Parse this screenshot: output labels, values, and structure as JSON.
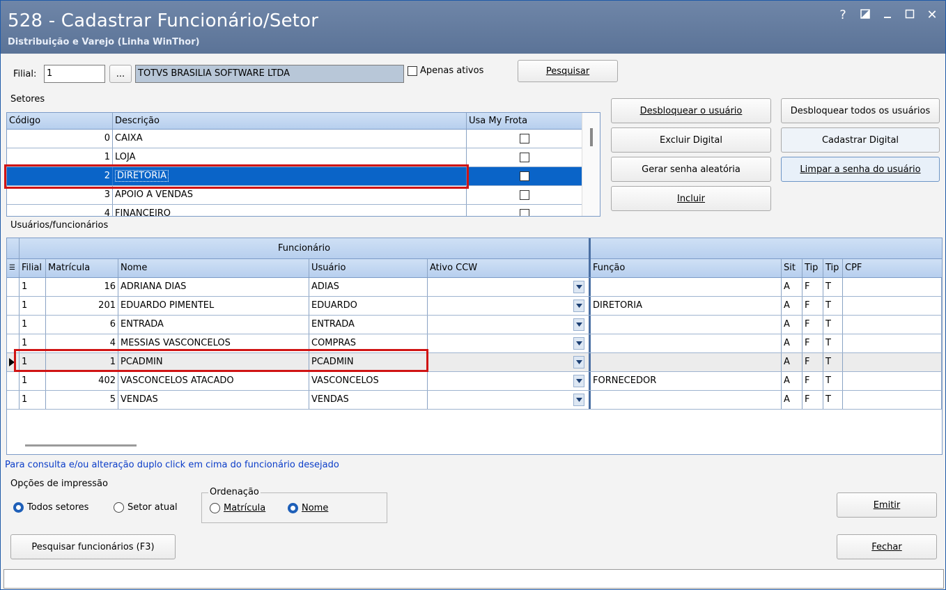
{
  "window": {
    "title": "528 - Cadastrar Funcionário/Setor",
    "subtitle": "Distribuição e Varejo (Linha WinThor)",
    "controls": [
      "help-icon",
      "restore-icon",
      "minimize-icon",
      "maximize-icon",
      "close-icon"
    ],
    "help_glyph": "?",
    "close_glyph": "✕"
  },
  "filter": {
    "filial_label": "Filial:",
    "filial_value": "1",
    "lookup_button": "...",
    "company_name": "TOTVS BRASILIA SOFTWARE LTDA",
    "apenas_ativos_label": "Apenas ativos",
    "pesquisar_label": "Pesquisar"
  },
  "setores": {
    "group_title": "Setores",
    "columns": [
      "Código",
      "Descrição",
      "Usa My Frota"
    ],
    "rows": [
      {
        "codigo": "0",
        "descricao": "CAIXA"
      },
      {
        "codigo": "1",
        "descricao": "LOJA"
      },
      {
        "codigo": "2",
        "descricao": "DIRETORIA"
      },
      {
        "codigo": "3",
        "descricao": "APOIO A VENDAS"
      },
      {
        "codigo": "4",
        "descricao": "FINANCEIRO"
      }
    ],
    "selected_index": 2
  },
  "actions": {
    "desbloquear_usuario": "Desbloquear o usuário",
    "desbloquear_todos": "Desbloquear todos os usuários",
    "excluir_digital": "Excluir Digital",
    "cadastrar_digital": "Cadastrar Digital",
    "gerar_senha": "Gerar senha aleatória",
    "limpar_senha": "Limpar a senha do usuário",
    "incluir": "Incluir"
  },
  "usuarios": {
    "group_title": "Usuários/funcionários",
    "band_title": "Funcionário",
    "columns": [
      "Filial",
      "Matrícula",
      "Nome",
      "Usuário",
      "Ativo CCW",
      "Função",
      "Sit",
      "Tip",
      "Tip",
      "CPF"
    ],
    "rows": [
      {
        "filial": "1",
        "matricula": "16",
        "nome": "ADRIANA DIAS",
        "usuario": "ADIAS",
        "funcao": "",
        "sit": "A",
        "tip1": "F",
        "tip2": "T"
      },
      {
        "filial": "1",
        "matricula": "201",
        "nome": "EDUARDO PIMENTEL",
        "usuario": "EDUARDO",
        "funcao": "DIRETORIA",
        "sit": "A",
        "tip1": "F",
        "tip2": "T"
      },
      {
        "filial": "1",
        "matricula": "6",
        "nome": "ENTRADA",
        "usuario": "ENTRADA",
        "funcao": "",
        "sit": "A",
        "tip1": "F",
        "tip2": "T"
      },
      {
        "filial": "1",
        "matricula": "4",
        "nome": "MESSIAS VASCONCELOS",
        "usuario": "COMPRAS",
        "funcao": "",
        "sit": "A",
        "tip1": "F",
        "tip2": "T"
      },
      {
        "filial": "1",
        "matricula": "1",
        "nome": "PCADMIN",
        "usuario": "PCADMIN",
        "funcao": "",
        "sit": "A",
        "tip1": "F",
        "tip2": "T"
      },
      {
        "filial": "1",
        "matricula": "402",
        "nome": "VASCONCELOS ATACADO",
        "usuario": "VASCONCELOS",
        "funcao": "FORNECEDOR",
        "sit": "A",
        "tip1": "F",
        "tip2": "T"
      },
      {
        "filial": "1",
        "matricula": "5",
        "nome": "VENDAS",
        "usuario": "VENDAS",
        "funcao": "",
        "sit": "A",
        "tip1": "F",
        "tip2": "T"
      }
    ],
    "current_index": 4
  },
  "hint": "Para consulta e/ou alteração duplo click em cima do funcionário desejado",
  "print_options": {
    "group_title": "Opções de impressão",
    "todos_setores": "Todos setores",
    "setor_atual": "Setor atual",
    "ordenacao_title": "Ordenação",
    "matricula": "Matrícula",
    "nome": "Nome",
    "emitir": "Emitir"
  },
  "footer": {
    "pesquisar_funcionarios": "Pesquisar funcionários (F3)",
    "fechar": "Fechar"
  },
  "colors": {
    "title_bar": "#6f86a8",
    "selection": "#0a64c8",
    "highlight_box": "#d01414",
    "grid_header": "#b7cfee",
    "hint_text": "#0a3cc8"
  }
}
